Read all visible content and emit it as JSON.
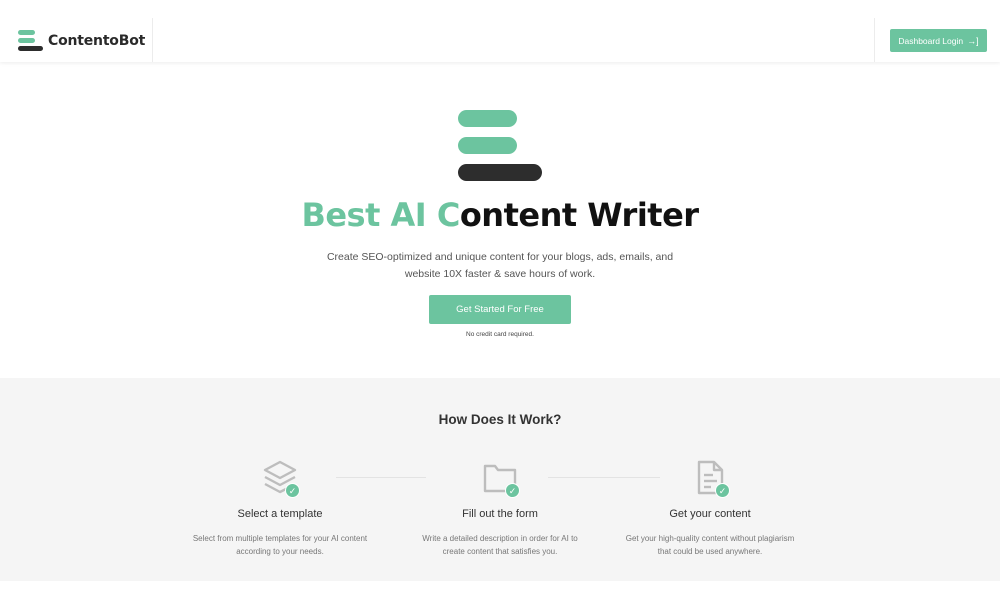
{
  "header": {
    "brand_name": "ContentoBot",
    "login_label": "Dashboard Login",
    "login_icon": "→]"
  },
  "hero": {
    "title_accent": "Best AI C",
    "title_rest": "ontent Writer",
    "subtitle": "Create SEO-optimized and unique content for your blogs, ads, emails, and website 10X faster & save hours of work.",
    "cta_label": "Get Started For Free",
    "cta_note": "No credit card required."
  },
  "how": {
    "title": "How Does It Work?",
    "steps": [
      {
        "icon": "layers-icon",
        "title": "Select a template",
        "desc": "Select from multiple templates for your AI content according to your needs."
      },
      {
        "icon": "folder-icon",
        "title": "Fill out the form",
        "desc": "Write a detailed description in order for AI to create content that satisfies you."
      },
      {
        "icon": "document-icon",
        "title": "Get your content",
        "desc": "Get your high-quality content without plagiarism that could be used anywhere."
      }
    ]
  },
  "colors": {
    "accent": "#6cc49f",
    "dark": "#2d2d2d",
    "section_bg": "#f5f5f5"
  }
}
